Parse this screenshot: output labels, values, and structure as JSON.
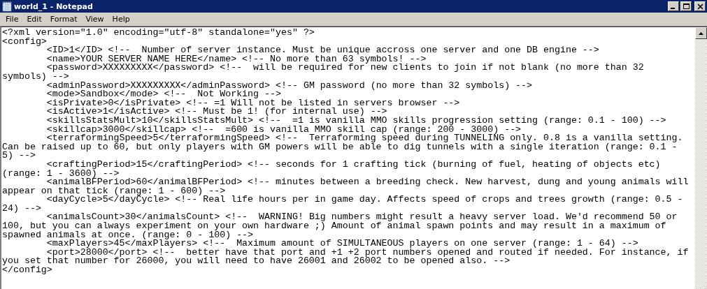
{
  "window": {
    "title": "world_1 - Notepad"
  },
  "menu": [
    "File",
    "Edit",
    "Format",
    "View",
    "Help"
  ],
  "lines": [
    "<?xml version=\"1.0\" encoding=\"utf-8\" standalone=\"yes\" ?>",
    "<config>",
    "\t<ID>1</ID> <!--  Number of server instance. Must be unique accross one server and one DB engine -->",
    "\t<name>YOUR SERVER NAME HERE</name> <!-- No more than 63 symbols! -->",
    "\t<password>XXXXXXXXX</password> <!--  will be required for new clients to join if not blank (no more than 32",
    "symbols) -->",
    "\t<adminPassword>XXXXXXXXX</adminPassword> <!-- GM password (no more than 32 symbols) -->",
    "\t<mode>Sandbox</mode> <!--  Not Working -->",
    "\t<isPrivate>0</isPrivate> <!-- =1 Will not be listed in servers browser -->",
    "\t<isActive>1</isActive> <!-- Must be 1! (for internal use) -->",
    "\t<skillsStatsMult>10</skillsStatsMult> <!--  =1 is vanilla MMO skills progression setting (range: 0.1 - 100) -->",
    "\t<skillcap>3000</skillcap> <!--  =600 is vanilla MMO skill cap (range: 200 - 3000) -->",
    "\t<terraformingSpeed>5</terraformingSpeed> <!--  Terraforming speed during TUNNELING only. 0.8 is a vanilla setting.",
    "Can be raised up to 60, but only players with GM powers will be able to dig tunnels with a single iteration (range: 0.1 -",
    "5) -->",
    "\t<craftingPeriod>15</craftingPeriod> <!-- seconds for 1 crafting tick (burning of fuel, heating of objects etc)",
    "(range: 1 - 3600) -->",
    "\t<animalBFPeriod>60</animalBFPeriod> <!-- minutes between a breeding check. New harvest, dung and young animals will",
    "appear on that tick (range: 1 - 600) -->",
    "\t<dayCycle>5</dayCycle> <!-- Real life hours per in game day. Affects speed of crops and trees growth (range: 0.5 -",
    "24) -->",
    "\t<animalsCount>30</animalsCount> <!--  WARNING! Big numbers might result a heavy server load. We'd recommend 50 or",
    "100, but you can always experiment on your own hardware ;) Amount of animal spawn points and may result in a maximum of",
    "spawned animals at once. (range: 0 - 100) -->",
    "\t<maxPlayers>45</maxPlayers> <!--  Maximum amount of SIMULTANEOUS players on one server (range: 1 - 64) -->",
    "\t<port>28000</port> <!--  better have that port and +1 +2 port numbers opened and routed if needed. For instance, if",
    "you set that number for 26000, you will need to have 26001 and 26002 to be opened also. -->",
    "</config>"
  ]
}
